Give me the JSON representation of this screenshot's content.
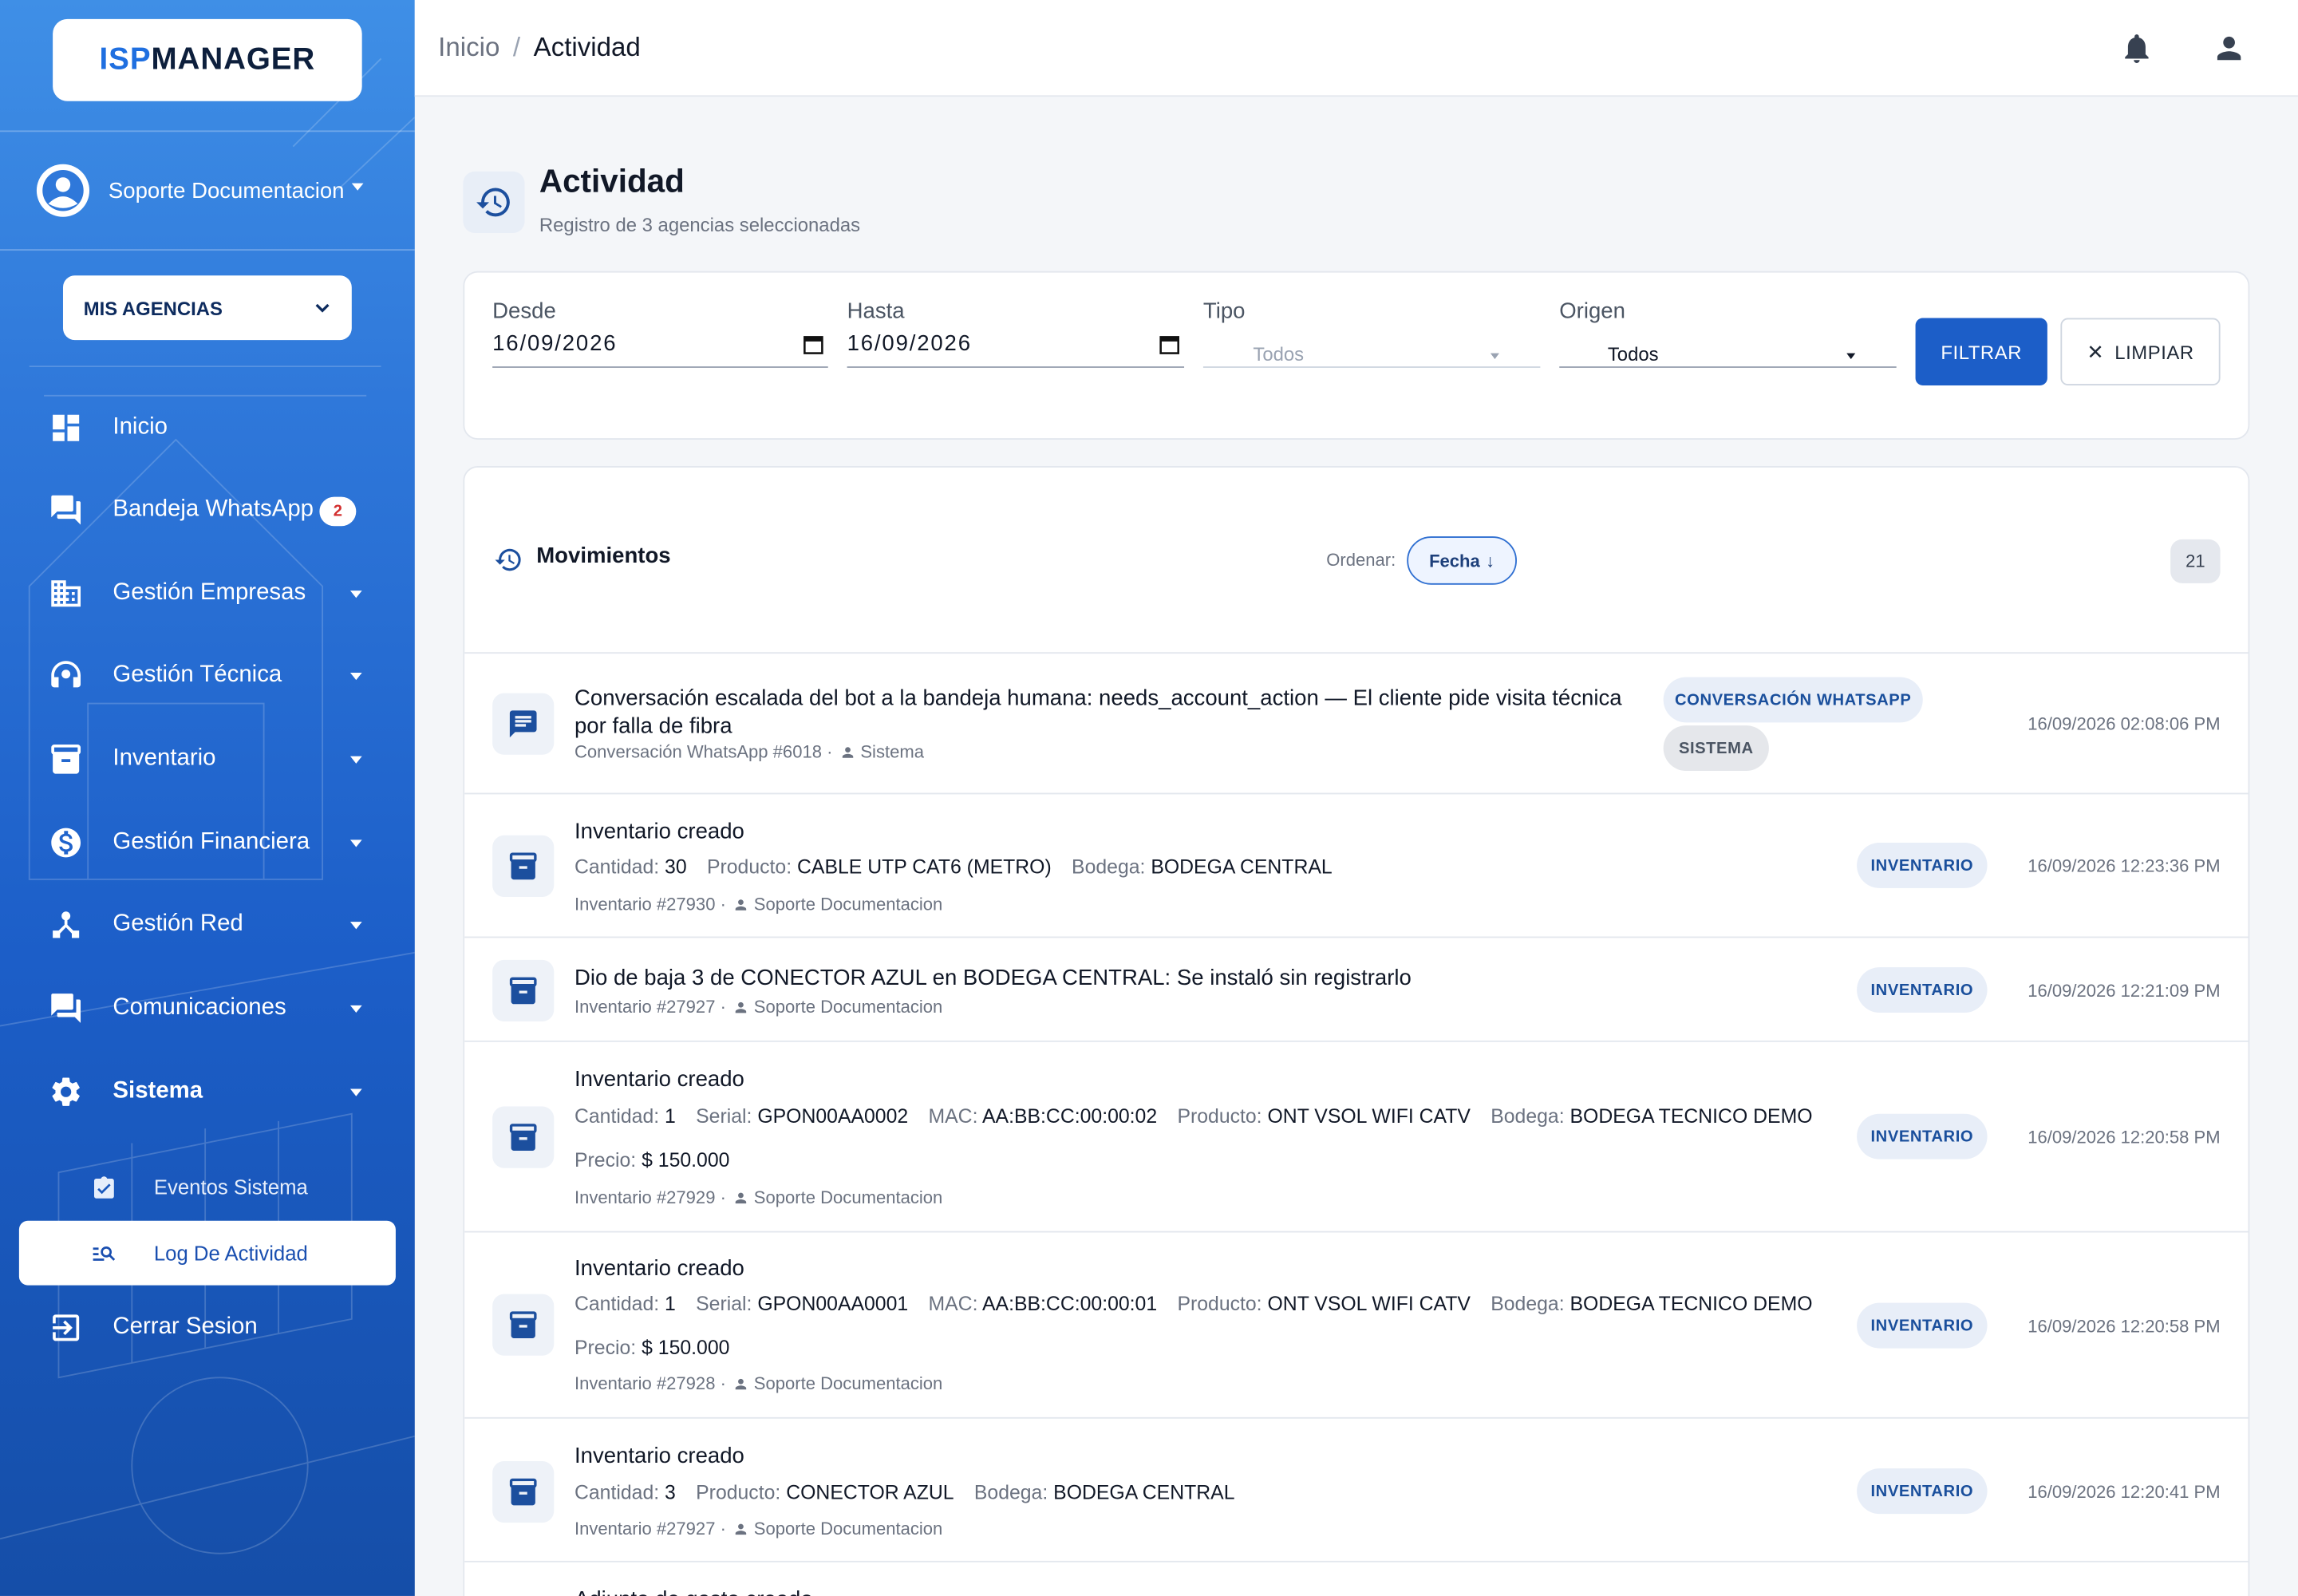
{
  "brand": {
    "part1": "ISP",
    "part2": "MANAGER"
  },
  "user": {
    "name": "Soporte Documentacion"
  },
  "agency_selector": {
    "label": "MIS AGENCIAS"
  },
  "nav": {
    "inicio": "Inicio",
    "whatsapp": "Bandeja WhatsApp",
    "whatsapp_badge": "2",
    "empresas": "Gestión Empresas",
    "tecnica": "Gestión Técnica",
    "inventario": "Inventario",
    "financiera": "Gestión Financiera",
    "red": "Gestión Red",
    "comunicaciones": "Comunicaciones",
    "sistema": "Sistema",
    "eventos": "Eventos Sistema",
    "log": "Log De Actividad",
    "logout": "Cerrar Sesion"
  },
  "breadcrumb": {
    "home": "Inicio",
    "sep": "/",
    "current": "Actividad"
  },
  "page": {
    "title": "Actividad",
    "subtitle": "Registro de 3 agencias seleccionadas"
  },
  "filters": {
    "desde_label": "Desde",
    "desde_value": "16/09/2026",
    "hasta_label": "Hasta",
    "hasta_value": "16/09/2026",
    "tipo_label": "Tipo",
    "tipo_value": "Todos",
    "origen_label": "Origen",
    "origen_value": "Todos",
    "filter_btn": "FILTRAR",
    "clear_btn": "LIMPIAR"
  },
  "list": {
    "title": "Movimientos",
    "order_label": "Ordenar:",
    "order_value": "Fecha",
    "count": "21"
  },
  "rows": [
    {
      "title": "Conversación escalada del bot a la bandeja humana: needs_account_action — El cliente pide visita técnica por falla de fibra",
      "ref": "Conversación WhatsApp #6018 ·",
      "actor": "Sistema",
      "chips": [
        "CONVERSACIÓN WHATSAPP",
        "SISTEMA"
      ],
      "date": "16/09/2026 02:08:06 PM"
    },
    {
      "title": "Inventario creado",
      "fields": [
        {
          "k": "Cantidad:",
          "v": "30"
        },
        {
          "k": "Producto:",
          "v": "CABLE UTP CAT6 (METRO)"
        },
        {
          "k": "Bodega:",
          "v": "BODEGA CENTRAL"
        }
      ],
      "ref": "Inventario #27930 ·",
      "actor": "Soporte Documentacion",
      "chip": "INVENTARIO",
      "date": "16/09/2026 12:23:36 PM"
    },
    {
      "title": "Dio de baja 3 de CONECTOR AZUL en BODEGA CENTRAL: Se instaló sin registrarlo",
      "ref": "Inventario #27927 ·",
      "actor": "Soporte Documentacion",
      "chip": "INVENTARIO",
      "date": "16/09/2026 12:21:09 PM"
    },
    {
      "title": "Inventario creado",
      "fields": [
        {
          "k": "Cantidad:",
          "v": "1"
        },
        {
          "k": "Serial:",
          "v": "GPON00AA0002"
        },
        {
          "k": "MAC:",
          "v": "AA:BB:CC:00:00:02"
        },
        {
          "k": "Producto:",
          "v": "ONT VSOL WIFI CATV"
        },
        {
          "k": "Bodega:",
          "v": "BODEGA TECNICO DEMO"
        }
      ],
      "price": {
        "k": "Precio:",
        "v": "$ 150.000"
      },
      "ref": "Inventario #27929 ·",
      "actor": "Soporte Documentacion",
      "chip": "INVENTARIO",
      "date": "16/09/2026 12:20:58 PM"
    },
    {
      "title": "Inventario creado",
      "fields": [
        {
          "k": "Cantidad:",
          "v": "1"
        },
        {
          "k": "Serial:",
          "v": "GPON00AA0001"
        },
        {
          "k": "MAC:",
          "v": "AA:BB:CC:00:00:01"
        },
        {
          "k": "Producto:",
          "v": "ONT VSOL WIFI CATV"
        },
        {
          "k": "Bodega:",
          "v": "BODEGA TECNICO DEMO"
        }
      ],
      "price": {
        "k": "Precio:",
        "v": "$ 150.000"
      },
      "ref": "Inventario #27928 ·",
      "actor": "Soporte Documentacion",
      "chip": "INVENTARIO",
      "date": "16/09/2026 12:20:58 PM"
    },
    {
      "title": "Inventario creado",
      "fields": [
        {
          "k": "Cantidad:",
          "v": "3"
        },
        {
          "k": "Producto:",
          "v": "CONECTOR AZUL"
        },
        {
          "k": "Bodega:",
          "v": "BODEGA CENTRAL"
        }
      ],
      "ref": "Inventario #27927 ·",
      "actor": "Soporte Documentacion",
      "chip": "INVENTARIO",
      "date": "16/09/2026 12:20:41 PM"
    },
    {
      "title": "Adjunto de gasto creado"
    }
  ],
  "colors": {
    "primary": "#1c5ec8",
    "sidebar_top": "#3f8fe6",
    "sidebar_bottom": "#154ea8",
    "chip_text": "#1a4f9c"
  }
}
